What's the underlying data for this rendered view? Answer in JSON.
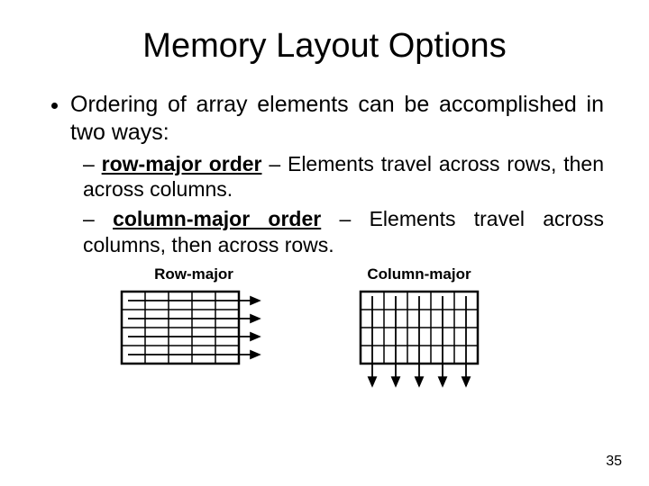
{
  "title": "Memory Layout Options",
  "bullet": {
    "main": "Ordering of array elements can be accomplished in two ways:",
    "items": [
      {
        "term": "row-major order",
        "desc": " – Elements travel across rows, then across columns."
      },
      {
        "term": "column-major order",
        "desc": " – Elements travel across columns, then across rows."
      }
    ]
  },
  "diagrams": {
    "row_label": "Row-major",
    "col_label": "Column-major"
  },
  "page_number": "35"
}
